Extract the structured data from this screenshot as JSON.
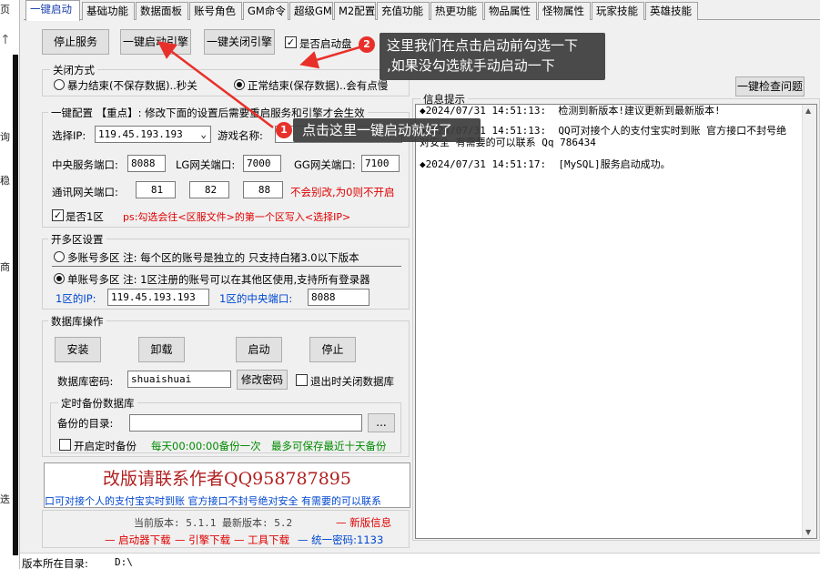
{
  "tabs": [
    "一键启动",
    "基础功能",
    "数据面板",
    "账号角色",
    "GM命令",
    "超级GM",
    "M2配置",
    "充值功能",
    "热更功能",
    "物品属性",
    "怪物属性",
    "玩家技能",
    "英雄技能"
  ],
  "left_strip": [
    "页",
    "个",
    "询",
    "商",
    "稳",
    "入",
    "迭"
  ],
  "toolbar": {
    "stop_service": "停止服务",
    "one_key_start": "一键启动引擎",
    "one_key_close": "一键关闭引擎",
    "auto_start_label": "是否启动盘",
    "auto_start_checked": true
  },
  "close_mode": {
    "title": "关闭方式",
    "violent": "暴力结束(不保存数据)..秒关",
    "normal": "正常结束(保存数据)..会有点慢",
    "selected": "normal"
  },
  "config": {
    "title": "一键配置 【重点】: 修改下面的设置后需要重启服务和引擎才会生效",
    "ip_label": "选择IP:",
    "ip_value": "119.45.193.193",
    "game_name_label": "游戏名称:",
    "center_port_label": "中央服务端口:",
    "center_port": "8088",
    "lg_port_label": "LG网关端口:",
    "lg_port": "7000",
    "gg_port_label": "GG网关端口:",
    "gg_port": "7100",
    "comm_port_label": "通讯网关端口:",
    "comm_port_1": "81",
    "comm_port_2": "82",
    "comm_port_3": "88",
    "no_change_note": "不会别改,为0则不开启",
    "zone1_label": "是否1区",
    "zone1_checked": true,
    "zone1_note": "ps:勾选会往<区服文件>的第一个区写入<选择IP>"
  },
  "multi_zone": {
    "title": "开多区设置",
    "multi_account": "多账号多区 注: 每个区的账号是独立的 只支持白猪3.0以下版本",
    "single_account": "单账号多区 注: 1区注册的账号可以在其他区使用,支持所有登录器",
    "selected": "single",
    "zone1_ip_label": "1区的IP:",
    "zone1_ip": "119.45.193.193",
    "zone1_port_label": "1区的中央端口:",
    "zone1_port": "8088"
  },
  "database": {
    "title": "数据库操作",
    "install": "安装",
    "uninstall": "卸载",
    "start": "启动",
    "stop": "停止",
    "password_label": "数据库密码:",
    "password": "shuaishuai",
    "change_password": "修改密码",
    "close_on_exit": "退出时关闭数据库",
    "close_on_exit_checked": false
  },
  "backup": {
    "title": "定时备份数据库",
    "dir_label": "备份的目录:",
    "dir_value": "",
    "browse": "...",
    "enable_label": "开启定时备份",
    "enable_checked": false,
    "daily_note": "每天00:00:00备份一次",
    "keep_note": "最多可保存最近十天备份"
  },
  "banner": {
    "contact": "改版请联系作者QQ958787895",
    "marquee": "口可对接个人的支付宝实时到账 官方接口不封号绝对安全 有需要的可以联系"
  },
  "version": {
    "line": "当前版本: 5.1.1 最新版本: 5.2",
    "news_link": "新版信息",
    "launcher_link": "启动器下载",
    "engine_link": "引擎下载",
    "tools_link": "工具下载",
    "password": "统一密码:1133"
  },
  "log": {
    "check_button": "一键检查问题",
    "group_title": "信息提示",
    "lines": [
      "◆2024/07/31 14:51:13:  检测到新版本!建议更新到最新版本!",
      "◆2024/07/31 14:51:13:  QQ可对接个人的支付宝实时到账 官方接口不封号绝对安全 有需要的可以联系 Qq 786434",
      "◆2024/07/31 14:51:17:  [MySQL]服务启动成功。"
    ]
  },
  "status": {
    "dir_label": "版本所在目录:",
    "dir_value": "D:\\"
  },
  "annotations": {
    "tip1_num": "1",
    "tip1_text": "点击这里一键启动就好了",
    "tip2_num": "2",
    "tip2_text_line1": "这里我们在点击启动前勾选一下",
    "tip2_text_line2": ",如果没勾选就手动启动一下"
  },
  "colors": {
    "accent_red": "#e00000",
    "accent_blue": "#0047d0",
    "accent_green": "#008a00",
    "tip_bg": "#3c3c3c",
    "badge": "#e8302a"
  }
}
